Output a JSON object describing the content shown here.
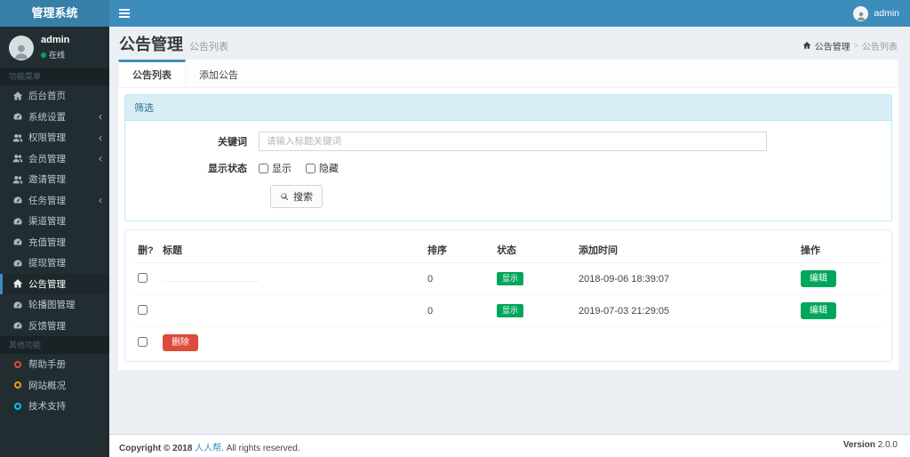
{
  "logo": {
    "title": "管理系统"
  },
  "navbar": {
    "username": "admin"
  },
  "sidebar": {
    "user_name": "admin",
    "user_status": "在线",
    "section_main": "功能菜单",
    "section_other": "其他功能",
    "items": [
      {
        "label": "后台首页",
        "icon": "home",
        "arrow": false,
        "active": false
      },
      {
        "label": "系统设置",
        "icon": "gauge",
        "arrow": true,
        "active": false
      },
      {
        "label": "权限管理",
        "icon": "users",
        "arrow": true,
        "active": false
      },
      {
        "label": "会员管理",
        "icon": "users",
        "arrow": true,
        "active": false
      },
      {
        "label": "邀请管理",
        "icon": "users",
        "arrow": false,
        "active": false
      },
      {
        "label": "任务管理",
        "icon": "gauge",
        "arrow": true,
        "active": false
      },
      {
        "label": "渠道管理",
        "icon": "gauge",
        "arrow": false,
        "active": false
      },
      {
        "label": "充值管理",
        "icon": "gauge",
        "arrow": false,
        "active": false
      },
      {
        "label": "提现管理",
        "icon": "gauge",
        "arrow": false,
        "active": false
      },
      {
        "label": "公告管理",
        "icon": "home",
        "arrow": false,
        "active": true
      },
      {
        "label": "轮播图管理",
        "icon": "gauge",
        "arrow": false,
        "active": false
      },
      {
        "label": "反馈管理",
        "icon": "gauge",
        "arrow": false,
        "active": false
      }
    ],
    "extra_items": [
      {
        "label": "帮助手册",
        "color": "#dd4b39"
      },
      {
        "label": "网站概况",
        "color": "#f39c12"
      },
      {
        "label": "技术支持",
        "color": "#00c0ef"
      }
    ]
  },
  "header": {
    "title": "公告管理",
    "subtitle": "公告列表",
    "breadcrumb": [
      "公告管理",
      "公告列表"
    ]
  },
  "tabs": [
    {
      "label": "公告列表",
      "active": true
    },
    {
      "label": "添加公告",
      "active": false
    }
  ],
  "filter": {
    "panel_title": "筛选",
    "keyword_label": "关键词",
    "keyword_placeholder": "请输入标题关键词",
    "status_label": "显示状态",
    "status_options": [
      "显示",
      "隐藏"
    ],
    "search_label": "搜索"
  },
  "table": {
    "columns": [
      "删?",
      "标题",
      "排序",
      "状态",
      "添加时间",
      "操作"
    ],
    "rows": [
      {
        "title": "",
        "masked": true,
        "sort": "0",
        "status": "显示",
        "time": "2018-09-06 18:39:07",
        "action": "编辑"
      },
      {
        "title": "",
        "masked": false,
        "sort": "0",
        "status": "显示",
        "time": "2019-07-03 21:29:05",
        "action": "编辑"
      }
    ],
    "delete_label": "删除"
  },
  "footer": {
    "copyright_prefix": "Copyright © 2018",
    "brand": "人人帮",
    "copyright_suffix": ". All rights reserved.",
    "version_label": "Version",
    "version": "2.0.0"
  },
  "colors": {
    "navbar": "#3c8dbc",
    "logo_bg": "#367fa9",
    "sidebar_bg": "#222d32",
    "green": "#00a65a",
    "red": "#dd4b39",
    "panel_info_bg": "#d9edf7"
  }
}
